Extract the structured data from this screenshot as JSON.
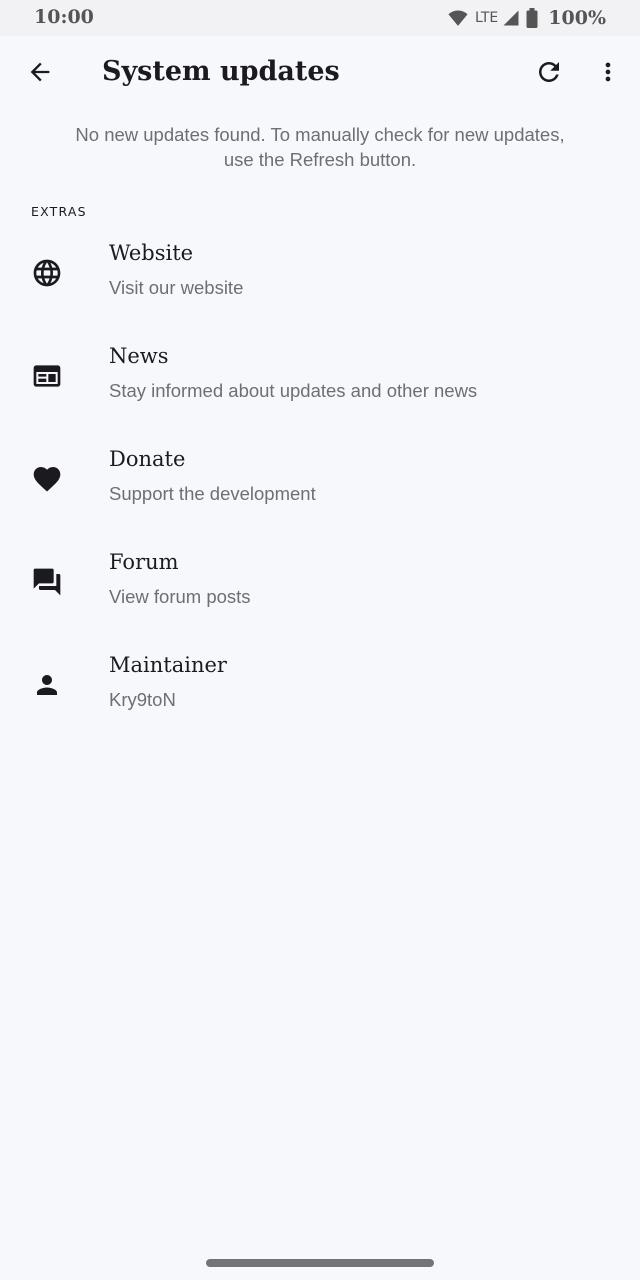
{
  "status_bar": {
    "time": "10:00",
    "network": "LTE",
    "battery": "100%",
    "icons": [
      "wifi-icon",
      "cell-signal-icon",
      "battery-icon"
    ]
  },
  "toolbar": {
    "title": "System updates",
    "icons": [
      "back-arrow-icon",
      "refresh-icon",
      "more-vert-icon"
    ]
  },
  "info": {
    "message": "No new updates found. To manually check for new updates, use the Refresh button."
  },
  "extras": {
    "header": "EXTRAS",
    "items": [
      {
        "icon": "globe-icon",
        "title": "Website",
        "subtitle": "Visit our website"
      },
      {
        "icon": "news-icon",
        "title": "News",
        "subtitle": "Stay informed about updates and other news"
      },
      {
        "icon": "heart-icon",
        "title": "Donate",
        "subtitle": "Support the development"
      },
      {
        "icon": "forum-icon",
        "title": "Forum",
        "subtitle": "View forum posts"
      },
      {
        "icon": "person-icon",
        "title": "Maintainer",
        "subtitle": "Kry9toN"
      }
    ]
  },
  "colors": {
    "background": "#f7f8fb",
    "status_bar": "#f2f2f4",
    "text_primary": "#1b1b1f",
    "text_secondary": "#6e6e74"
  }
}
